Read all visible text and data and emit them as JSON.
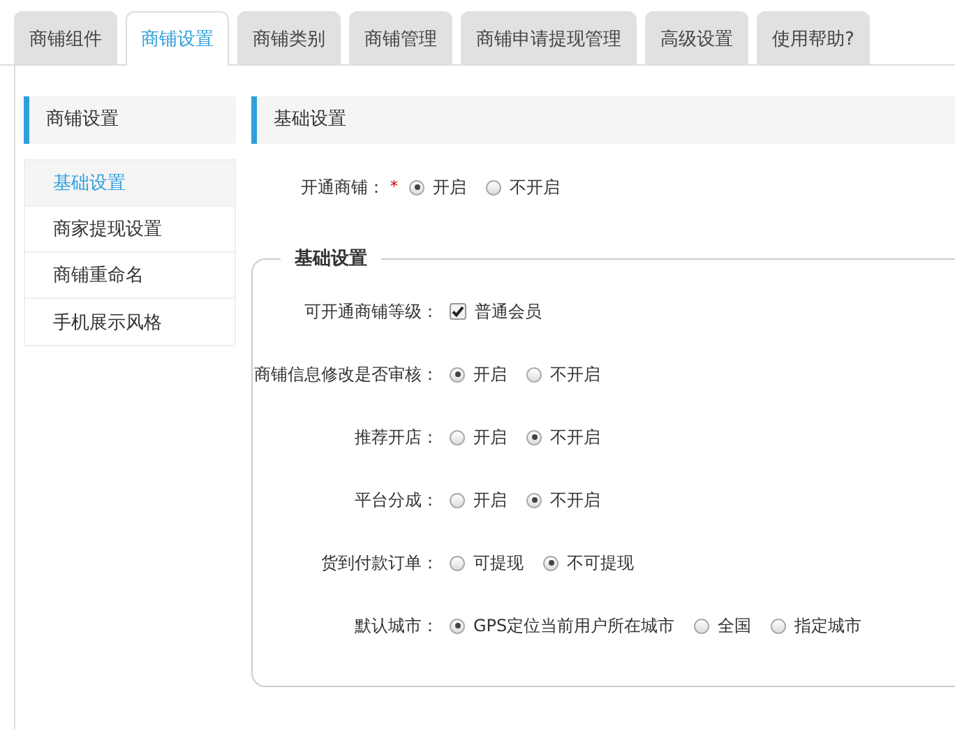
{
  "tabs": [
    {
      "label": "商铺组件",
      "selected": false
    },
    {
      "label": "商铺设置",
      "selected": true
    },
    {
      "label": "商铺类别",
      "selected": false
    },
    {
      "label": "商铺管理",
      "selected": false
    },
    {
      "label": "商铺申请提现管理",
      "selected": false
    },
    {
      "label": "高级设置",
      "selected": false
    },
    {
      "label": "使用帮助?",
      "selected": false
    }
  ],
  "sidebar": {
    "title": "商铺设置",
    "items": [
      {
        "label": "基础设置",
        "selected": true
      },
      {
        "label": "商家提现设置",
        "selected": false
      },
      {
        "label": "商铺重命名",
        "selected": false
      },
      {
        "label": "手机展示风格",
        "selected": false
      }
    ]
  },
  "main": {
    "title": "基础设置",
    "top_field": {
      "label": "开通商铺：",
      "required_mark": "*",
      "kind": "radio",
      "options": [
        {
          "label": "开启",
          "selected": true
        },
        {
          "label": "不开启",
          "selected": false
        }
      ]
    },
    "fieldset": {
      "legend": "基础设置",
      "fields": [
        {
          "label": "可开通商铺等级：",
          "kind": "checkbox",
          "options": [
            {
              "label": "普通会员",
              "checked": true
            }
          ]
        },
        {
          "label": "商铺信息修改是否审核：",
          "kind": "radio",
          "options": [
            {
              "label": "开启",
              "selected": true
            },
            {
              "label": "不开启",
              "selected": false
            }
          ]
        },
        {
          "label": "推荐开店：",
          "kind": "radio",
          "options": [
            {
              "label": "开启",
              "selected": false
            },
            {
              "label": "不开启",
              "selected": true
            }
          ]
        },
        {
          "label": "平台分成：",
          "kind": "radio",
          "options": [
            {
              "label": "开启",
              "selected": false
            },
            {
              "label": "不开启",
              "selected": true
            }
          ]
        },
        {
          "label": "货到付款订单：",
          "kind": "radio",
          "options": [
            {
              "label": "可提现",
              "selected": false
            },
            {
              "label": "不可提现",
              "selected": true
            }
          ]
        },
        {
          "label": "默认城市：",
          "kind": "radio",
          "options": [
            {
              "label": "GPS定位当前用户所在城市",
              "selected": true
            },
            {
              "label": "全国",
              "selected": false
            },
            {
              "label": "指定城市",
              "selected": false
            }
          ]
        }
      ]
    }
  }
}
